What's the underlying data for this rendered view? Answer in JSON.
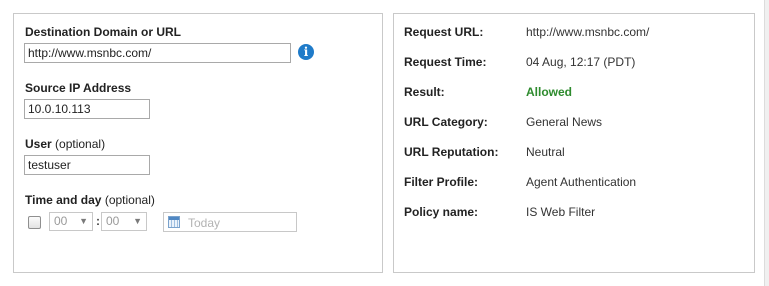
{
  "form": {
    "destination": {
      "label": "Destination Domain or URL",
      "value": "http://www.msnbc.com/"
    },
    "source_ip": {
      "label": "Source IP Address",
      "value": "10.0.10.113"
    },
    "user": {
      "label": "User",
      "optional": "(optional)",
      "value": "testuser"
    },
    "time_and_day": {
      "label": "Time and day",
      "optional": "(optional)",
      "hour": "00",
      "minute": "00",
      "colon": ":",
      "date_placeholder": "Today"
    },
    "info_icon": "i"
  },
  "results": {
    "rows": [
      {
        "label": "Request URL:",
        "value": "http://www.msnbc.com/"
      },
      {
        "label": "Request Time:",
        "value": "04 Aug, 12:17 (PDT)"
      },
      {
        "label": "Result:",
        "value": "Allowed"
      },
      {
        "label": "URL Category:",
        "value": "General News"
      },
      {
        "label": "URL Reputation:",
        "value": "Neutral"
      },
      {
        "label": "Filter Profile:",
        "value": "Agent Authentication"
      },
      {
        "label": "Policy name:",
        "value": "IS Web Filter"
      }
    ],
    "allowed_color": "#2e8b2e"
  },
  "icons": {
    "info": "info-icon",
    "calendar": "calendar-icon",
    "dropdown": "chevron-down-icon"
  },
  "colors": {
    "info_icon": "#1f7bc9",
    "panel_border": "#c9c9c9"
  }
}
